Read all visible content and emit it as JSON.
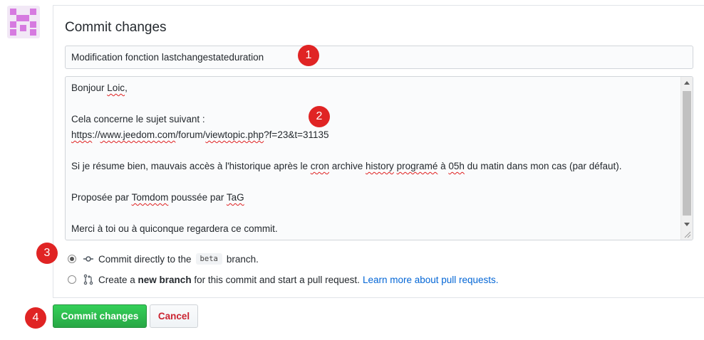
{
  "header": {
    "title": "Commit changes"
  },
  "form": {
    "summary_value": "Modification fonction lastchangestateduration",
    "description_lines": [
      [
        {
          "t": "Bonjour "
        },
        {
          "t": "Loic",
          "sq": true
        },
        {
          "t": ","
        }
      ],
      [],
      [
        {
          "t": "Cela concerne le sujet suivant :"
        }
      ],
      [
        {
          "t": "https",
          "sq": true
        },
        {
          "t": "://"
        },
        {
          "t": "www.jeedom.com",
          "sq": true
        },
        {
          "t": "/forum/"
        },
        {
          "t": "viewtopic.php",
          "sq": true
        },
        {
          "t": "?f=23&t=31135"
        }
      ],
      [],
      [
        {
          "t": "Si je résume bien, mauvais accès à l'historique après le "
        },
        {
          "t": "cron",
          "sq": true
        },
        {
          "t": " archive "
        },
        {
          "t": "history",
          "sq": true
        },
        {
          "t": " "
        },
        {
          "t": "programé",
          "sq": true
        },
        {
          "t": " à "
        },
        {
          "t": "05h",
          "sq": true
        },
        {
          "t": " du matin dans mon cas (par défaut)."
        }
      ],
      [],
      [
        {
          "t": "Proposée par "
        },
        {
          "t": "Tomdom",
          "sq": true
        },
        {
          "t": " poussée par "
        },
        {
          "t": "TaG",
          "sq": true
        }
      ],
      [],
      [
        {
          "t": "Merci à toi ou à quiconque regardera ce commit."
        }
      ]
    ]
  },
  "options": {
    "direct": {
      "prefix": "Commit directly to the",
      "branch": "beta",
      "suffix": "branch.",
      "selected": true
    },
    "new_branch": {
      "prefix": "Create a",
      "bold": "new branch",
      "suffix": "for this commit and start a pull request.",
      "link": "Learn more about pull requests.",
      "selected": false
    }
  },
  "actions": {
    "commit_label": "Commit changes",
    "cancel_label": "Cancel"
  },
  "markers": [
    "1",
    "2",
    "3",
    "4"
  ],
  "colors": {
    "commit_button": "#28a745",
    "cancel_text": "#cb2431",
    "link": "#0366d6",
    "marker": "#e02424",
    "avatar": "#d67ae0"
  },
  "icons": {
    "avatar": "identicon-avatar",
    "direct_commit": "git-commit-icon",
    "new_branch": "git-pull-request-icon"
  }
}
